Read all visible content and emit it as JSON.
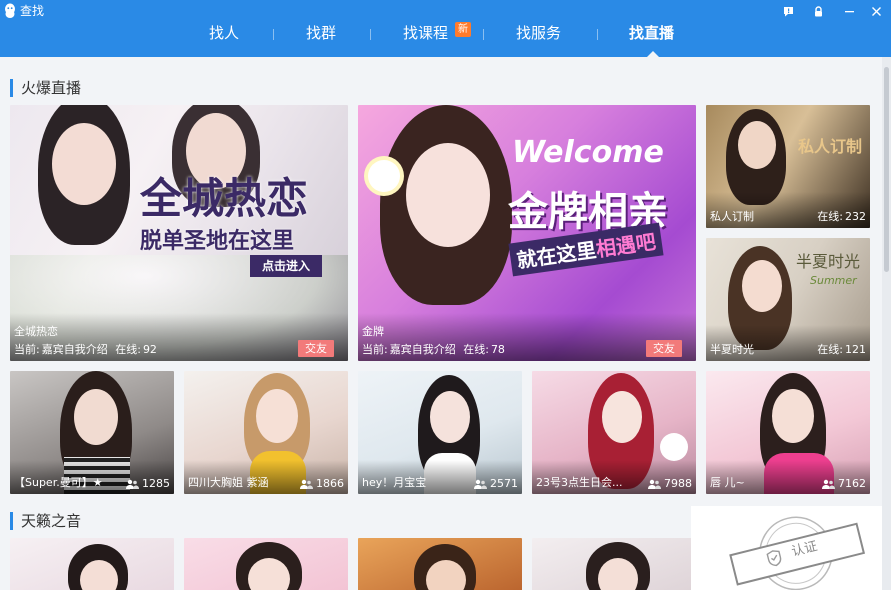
{
  "window": {
    "title": "查找"
  },
  "tabs": [
    {
      "label": "找人"
    },
    {
      "label": "找群"
    },
    {
      "label": "找课程",
      "badge": "新"
    },
    {
      "label": "找服务"
    },
    {
      "label": "找直播",
      "active": true
    }
  ],
  "sections": {
    "hot_live": "火爆直播",
    "heavenly_voices": "天籁之音"
  },
  "featured": [
    {
      "name": "全城热恋",
      "current_prefix": "当前:",
      "current": "嘉宾自我介绍",
      "online_prefix": "在线:",
      "online": "92",
      "tag": "交友",
      "poster_line1": "全城热恋",
      "poster_line2": "脱单圣地在这里",
      "poster_button": "点击进入"
    },
    {
      "name": "金牌",
      "current_prefix": "当前:",
      "current": "嘉宾自我介绍",
      "online_prefix": "在线:",
      "online": "78",
      "tag": "交友",
      "poster_welcome": "Welcome",
      "poster_line1": "金牌相亲",
      "poster_line2_a": "就在这里",
      "poster_line2_b": "相遇吧"
    }
  ],
  "side_cards": [
    {
      "name": "私人订制",
      "online_prefix": "在线:",
      "online": "232",
      "poster_text": "私人订制"
    },
    {
      "name": "半夏时光",
      "online_prefix": "在线:",
      "online": "121",
      "poster_text": "半夏时光",
      "poster_sub": "Summer"
    }
  ],
  "streamers": [
    {
      "name": "【Super.曼可】★",
      "viewers": "1285"
    },
    {
      "name": "四川大胸姐 紫涵",
      "viewers": "1866"
    },
    {
      "name": "hey！月宝宝",
      "viewers": "2571"
    },
    {
      "name": "23号3点生日会...",
      "viewers": "7988"
    },
    {
      "name": "唇 儿~",
      "viewers": "7162"
    }
  ],
  "stamp": {
    "text": "认证"
  },
  "colors": {
    "accent": "#2a8ae6",
    "tag": "#f27a7a",
    "badge": "#ff7b2c"
  }
}
